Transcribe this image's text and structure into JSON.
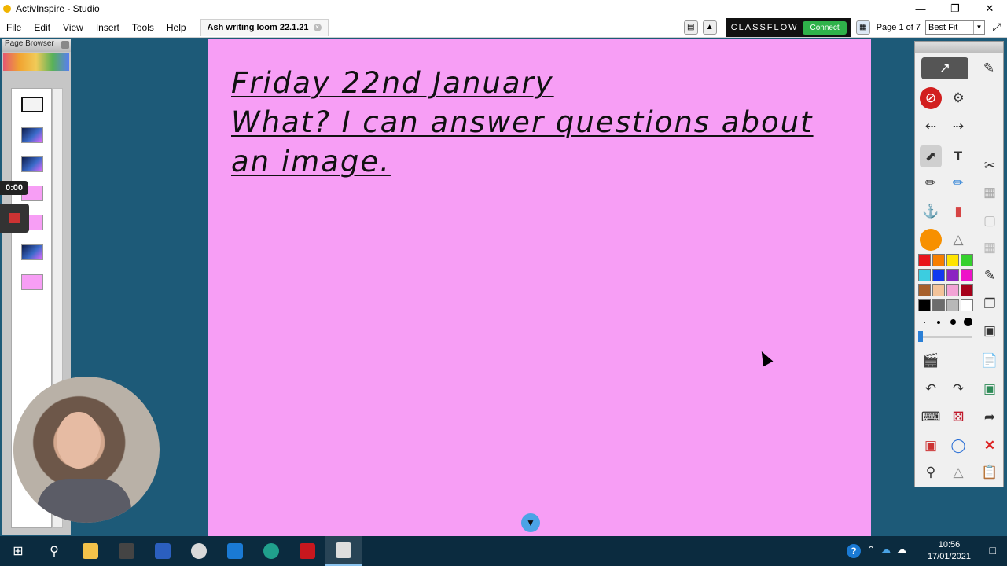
{
  "window": {
    "title": "ActivInspire - Studio"
  },
  "menu": {
    "items": [
      "File",
      "Edit",
      "View",
      "Insert",
      "Tools",
      "Help"
    ]
  },
  "document_tab": {
    "label": "Ash writing loom 22.1.21"
  },
  "classflow": {
    "brand": "CLASSFLOW",
    "connect_label": "Connect"
  },
  "pagination": {
    "label": "Page 1 of 7"
  },
  "zoom": {
    "selected": "Best Fit"
  },
  "page_browser": {
    "title": "Page Browser",
    "thumbnails": 7,
    "selected_index": 0
  },
  "recording": {
    "time": "0:00"
  },
  "flipchart": {
    "background": "#f79ef5",
    "lines": [
      "Friday 22nd January",
      "What? I can answer questions about",
      "an image."
    ]
  },
  "toolbox": {
    "palette": [
      "#e8141b",
      "#f77f00",
      "#ffe400",
      "#35d12d",
      "#3ccde0",
      "#1238f0",
      "#8b23c2",
      "#ee12c8",
      "#a8602a",
      "#f3c39a",
      "#f2a3d6",
      "#a6001a",
      "#000000",
      "#6c6c6c",
      "#b8b8b8",
      "#ffffff"
    ]
  },
  "taskbar": {
    "apps": [
      "start",
      "search",
      "file-explorer",
      "sims",
      "word",
      "paint",
      "outlook",
      "edge",
      "acrobat",
      "activinspire"
    ],
    "time": "10:56",
    "date": "17/01/2021"
  }
}
